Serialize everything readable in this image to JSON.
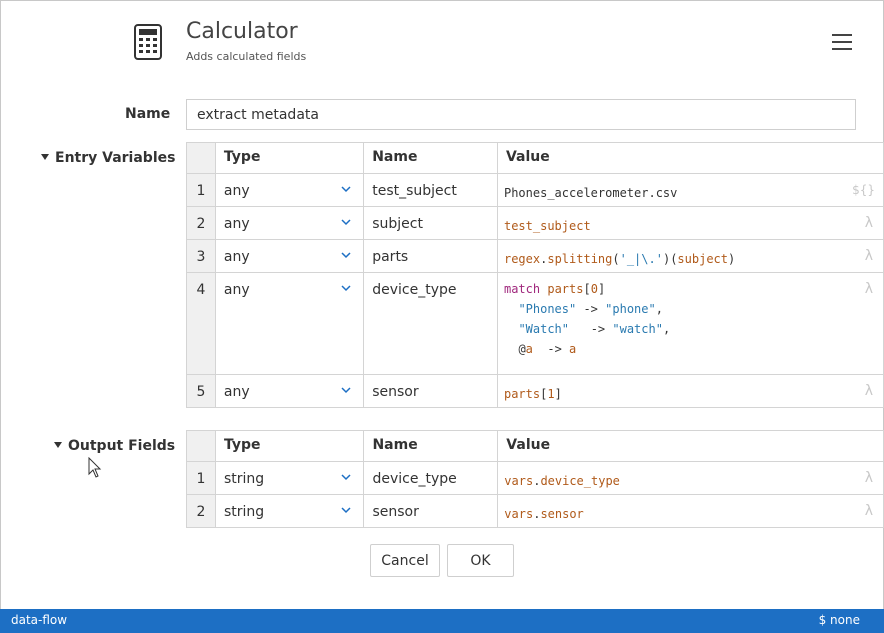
{
  "header": {
    "title": "Calculator",
    "subtitle": "Adds calculated fields",
    "icon": "calculator-icon",
    "menu_icon": "hamburger-menu-icon"
  },
  "name_field": {
    "label": "Name",
    "value": "extract metadata"
  },
  "entry_variables": {
    "label": "Entry Variables",
    "columns": [
      "Type",
      "Name",
      "Value"
    ],
    "rows": [
      {
        "index": "1",
        "type": "any",
        "name": "test_subject",
        "value_plain": "Phones_accelerometer.csv",
        "value_kind": "literal"
      },
      {
        "index": "2",
        "type": "any",
        "name": "subject",
        "value_kind": "expression"
      },
      {
        "index": "3",
        "type": "any",
        "name": "parts",
        "value_kind": "expression"
      },
      {
        "index": "4",
        "type": "any",
        "name": "device_type",
        "value_kind": "expression"
      },
      {
        "index": "5",
        "type": "any",
        "name": "sensor",
        "value_kind": "expression"
      }
    ]
  },
  "output_fields": {
    "label": "Output Fields",
    "columns": [
      "Type",
      "Name",
      "Value"
    ],
    "rows": [
      {
        "index": "1",
        "type": "string",
        "name": "device_type",
        "value_kind": "expression"
      },
      {
        "index": "2",
        "type": "string",
        "name": "sensor",
        "value_kind": "expression"
      }
    ]
  },
  "tokens": {
    "test_subject": "test_subject",
    "regex": "regex",
    "dot": ".",
    "splitting": "splitting",
    "paren_open": "(",
    "regex_arg": "'_|\\.'",
    "paren_close_open": ")(",
    "subject": "subject",
    "paren_close": ")",
    "match": "match",
    "parts": "parts",
    "idx0": "0",
    "idx1": "1",
    "lbr": "[",
    "rbr": "]",
    "phones_str": "\"Phones\"",
    "phone_str": "\"phone\"",
    "watch_str": "\"Watch\"",
    "watch_lc_str": "\"watch\"",
    "arrow": " -> ",
    "comma": ",",
    "at": "@",
    "a": "a",
    "vars": "vars",
    "device_type": "device_type",
    "sensor": "sensor"
  },
  "icons": {
    "expression_toggle": "lambda-icon",
    "template_toggle": "template-icon",
    "dropdown": "chevron-down-icon"
  },
  "lambda_glyph": "λ",
  "template_glyph": "${}",
  "buttons": {
    "cancel": "Cancel",
    "ok": "OK"
  },
  "status_bar": {
    "left": "data-flow",
    "right": "$ none"
  },
  "colors": {
    "status_bar": "#1d6fc4",
    "keyword": "#a0287d",
    "variable": "#b05a1a",
    "string": "#2a7ab0"
  }
}
